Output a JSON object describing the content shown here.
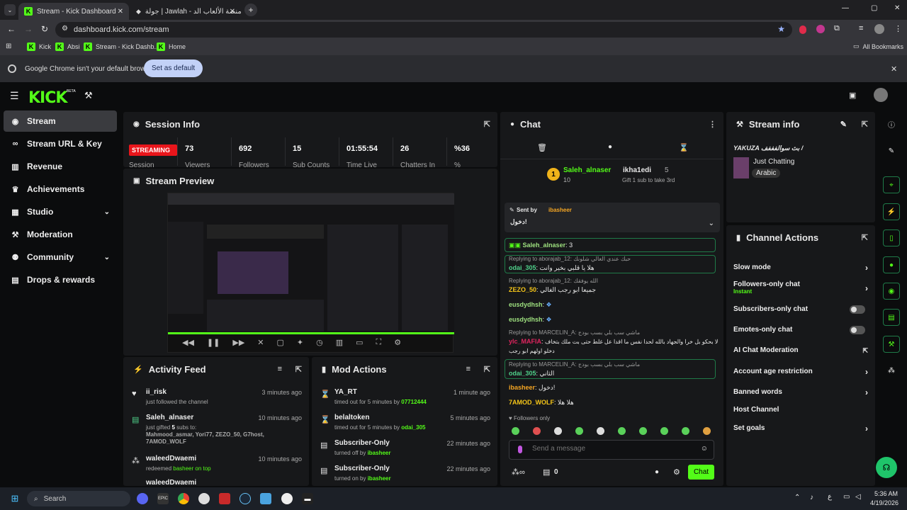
{
  "browser": {
    "tabs": [
      {
        "title": "Stream - Kick Dashboard"
      },
      {
        "title": "جولة | Jawlah - منصة الألعاب الد"
      }
    ],
    "url": "dashboard.kick.com/stream",
    "bookmarks": [
      "Kick",
      "Absi",
      "Stream - Kick Dashb...",
      "Home"
    ],
    "all_bookmarks": "All Bookmarks",
    "infobar_text": "Google Chrome isn't your default browser",
    "set_default": "Set as default"
  },
  "logo": "KICK",
  "logo_badge": "BETA",
  "sidebar": [
    {
      "label": "Stream",
      "icon": "broadcast-icon"
    },
    {
      "label": "Stream URL & Key",
      "icon": "link-icon"
    },
    {
      "label": "Revenue",
      "icon": "chart-icon"
    },
    {
      "label": "Achievements",
      "icon": "trophy-icon"
    },
    {
      "label": "Studio",
      "icon": "film-icon"
    },
    {
      "label": "Moderation",
      "icon": "hammer-icon"
    },
    {
      "label": "Community",
      "icon": "people-icon"
    },
    {
      "label": "Drops & rewards",
      "icon": "gift-icon"
    }
  ],
  "session": {
    "title": "Session Info",
    "status": "STREAMING",
    "status_sub": "Session",
    "stats": [
      {
        "value": "73",
        "label": "Viewers"
      },
      {
        "value": "692",
        "label": "Followers"
      },
      {
        "value": "15",
        "label": "Sub Counts"
      },
      {
        "value": "01:55:54",
        "label": "Time Live"
      },
      {
        "value": "26",
        "label": "Chatters In"
      },
      {
        "value": "%36",
        "label": "%"
      }
    ]
  },
  "preview": {
    "title": "Stream Preview"
  },
  "activity": {
    "title": "Activity Feed",
    "items": [
      {
        "name": "ii_risk",
        "desc": "just followed the channel",
        "time": "3 minutes ago"
      },
      {
        "name": "Saleh_alnaser",
        "desc_pre": "just gifted ",
        "desc_num": "5",
        "desc_post": " subs to:",
        "recipients": "Mahmood_asmar, Yori77, ZEZO_50, G7host, 7AMOD_WOLF",
        "time": "10 minutes ago"
      },
      {
        "name": "waleedDwaemi",
        "desc_pre": "redeemed ",
        "desc_hl": "basheer on top",
        "time": "10 minutes ago"
      },
      {
        "name": "waleedDwaemi",
        "time": ""
      }
    ]
  },
  "mod": {
    "title": "Mod Actions",
    "items": [
      {
        "name": "YA_RT",
        "desc": "timed out for 5 minutes by ",
        "by": "07712444",
        "time": "1 minute ago"
      },
      {
        "name": "belaltoken",
        "desc": "timed out for 5 minutes by ",
        "by": "odai_305",
        "time": "5 minutes ago"
      },
      {
        "name": "Subscriber-Only",
        "desc": "turned off by ",
        "by": "ibasheer",
        "time": "22 minutes ago"
      },
      {
        "name": "Subscriber-Only",
        "desc": "turned on by ",
        "by": "ibasheer",
        "time": "22 minutes ago"
      }
    ]
  },
  "chat": {
    "title": "Chat",
    "leader1": {
      "rank": "1",
      "name": "Saleh_alnaser",
      "count": "10"
    },
    "leader2": {
      "name": "ikha1edi",
      "count": "5",
      "sub": "Gift 1 sub to take 3rd"
    },
    "pinned": {
      "sent_by": "Sent by",
      "author": "ibasheer",
      "text": "دخول!"
    },
    "lines": [
      {
        "reply": "Replying to aborajab_12: ",
        "user": "Saleh_alnaser",
        "msg": "3"
      },
      {
        "reply": "Replying to aborajab_12: حبك عندي الغالي شلونك",
        "user": "odai_305",
        "msg": "هلا يا قلبي بخير وانت"
      },
      {
        "reply": "Replying to aborajab_12: الله يوفقك",
        "user": "ZEZO_50",
        "msg": "جميعا ابو رجب الغالي"
      },
      {
        "user": "eusdydhsh",
        "msg": ""
      },
      {
        "user": "eusdydhsh",
        "msg": ""
      },
      {
        "reply": "Replying to MARCELIN_A: ماشي سب بلي بسب بودج",
        "user": "ylc_MAFIA",
        "msg": "لا بحكو بل خرا والجهاد بالله لحدا نفس ما اقدا عل غلط حتى بت ملك بتخاف"
      },
      {
        "extra": "دخلو اولهم ابو رجب"
      },
      {
        "reply": "Replying to MARCELIN_A: ماشي سب بلي بسب بودج",
        "user": "odai_305",
        "msg": "الثاني"
      },
      {
        "user": "ibasheer",
        "msg": "دخول!"
      },
      {
        "user": "7AMOD_WOLF",
        "msg": "هلا هلا"
      }
    ],
    "followers_only": "Followers only",
    "placeholder": "Send a message",
    "count": "0",
    "send": "Chat"
  },
  "stream_info": {
    "title": "Stream info",
    "stream_title": "YAKUZA بث سوالفففف /",
    "category": "Just Chatting",
    "language": "Arabic"
  },
  "channel_actions": {
    "title": "Channel Actions",
    "items": [
      {
        "label": "Slow mode",
        "kind": "arrow"
      },
      {
        "label": "Followers-only chat",
        "sub": "Instant",
        "kind": "arrow"
      },
      {
        "label": "Subscribers-only chat",
        "kind": "toggle"
      },
      {
        "label": "Emotes-only chat",
        "kind": "toggle"
      },
      {
        "label": "AI Chat Moderation",
        "kind": "ext"
      },
      {
        "label": "Account age restriction",
        "kind": "arrow"
      },
      {
        "label": "Banned words",
        "kind": "arrow"
      },
      {
        "label": "Host Channel",
        "kind": "none"
      },
      {
        "label": "Set goals",
        "kind": "arrow"
      }
    ]
  },
  "taskbar": {
    "search": "Search",
    "time": "5:36 AM",
    "date": "4/19/2026",
    "lang": "ع"
  },
  "colors": {
    "accent": "#53fc18",
    "streaming": "#e9151b",
    "panel": "#17181a"
  }
}
